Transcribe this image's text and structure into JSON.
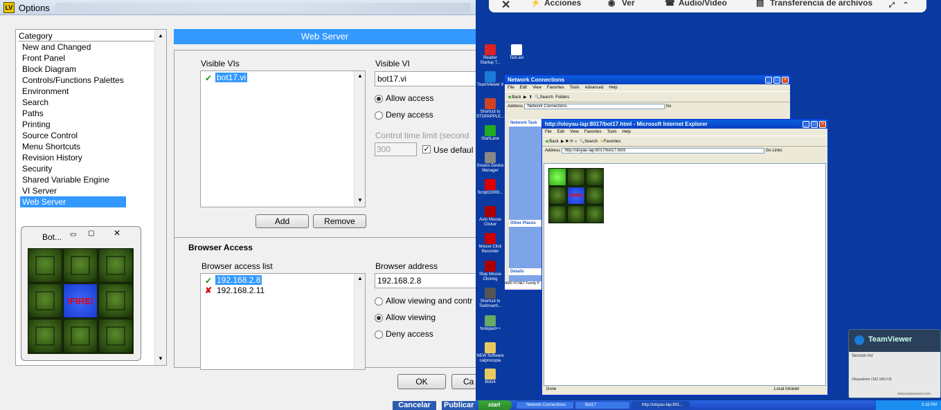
{
  "options": {
    "title": "Options",
    "category_header": "Category",
    "categories": [
      "New and Changed",
      "Front Panel",
      "Block Diagram",
      "Controls/Functions Palettes",
      "Environment",
      "Search",
      "Paths",
      "Printing",
      "Source Control",
      "Menu Shortcuts",
      "Revision History",
      "Security",
      "Shared Variable Engine",
      "VI Server",
      "Web Server"
    ],
    "selected_category": "Web Server",
    "section_title": "Web Server",
    "visible_vis_label": "Visible VIs",
    "visible_vis": [
      {
        "name": "bot17.vi",
        "status": "allowed"
      }
    ],
    "visible_vi_label": "Visible VI",
    "visible_vi_value": "bot17.vi",
    "allow_access": "Allow access",
    "deny_access": "Deny access",
    "control_time_limit": "Control time limit (second",
    "time_limit_value": "300",
    "use_default": "Use defaul",
    "add": "Add",
    "remove": "Remove",
    "browser_access_title": "Browser Access",
    "browser_access_list_label": "Browser access list",
    "browser_list": [
      {
        "addr": "192.168.2.8",
        "status": "allowed"
      },
      {
        "addr": "192.168.2.11",
        "status": "denied"
      }
    ],
    "browser_address_label": "Browser address",
    "browser_address_value": "192.168.2.8",
    "allow_viewing_control": "Allow viewing and contr",
    "allow_viewing": "Allow viewing",
    "deny_access_b": "Deny access",
    "ok": "OK",
    "cancel_partial": "Ca"
  },
  "bot_panel": {
    "title": "Bot...",
    "fire_label": "!FIRE!"
  },
  "desktop": {
    "teamviewer_bar": [
      "Acciones",
      "Ver",
      "Audio/Video",
      "Transferencia de archivos"
    ],
    "icons": [
      {
        "label": "Reader Startup T...",
        "color": "#d22"
      },
      {
        "label": "TeamViewer 9",
        "color": "#1a7ad8"
      },
      {
        "label": "Shortcut to STOPAPPLE...",
        "color": "#c42"
      },
      {
        "label": "StartLane",
        "color": "#2a2"
      },
      {
        "label": "Sixaxis Device Manager",
        "color": "#888"
      },
      {
        "label": "Script10000...",
        "color": "#d00"
      },
      {
        "label": "Auto Mouse Clicker",
        "color": "#a00"
      },
      {
        "label": "Mouse Click Recorder",
        "color": "#c00"
      },
      {
        "label": "Stop Mouse Clicking",
        "color": "#a00"
      },
      {
        "label": "Shortcut to TextInserti...",
        "color": "#555"
      },
      {
        "label": "Notepad++",
        "color": "#6a6"
      },
      {
        "label": "NEW Software calprocopia",
        "color": "#e8c860"
      },
      {
        "label": "Bots4",
        "color": "#e8c860"
      }
    ],
    "icon2": "Test.avi",
    "net_window": {
      "title": "Network Connections",
      "menu": [
        "File",
        "Edit",
        "View",
        "Favorites",
        "Tools",
        "Advanced",
        "Help"
      ],
      "back": "Back",
      "search": "Search",
      "folders": "Folders",
      "address_label": "Address",
      "address": "Network Connections",
      "go": "Go",
      "tasks": "Network Task",
      "other_places": "Other Places",
      "details": "Details",
      "status": "AMD PCNET Family P"
    },
    "ie_window": {
      "title": "http://oloyau-lap:8017/bot17.html - Microsoft Internet Explorer",
      "menu": [
        "File",
        "Edit",
        "View",
        "Favorites",
        "Tools",
        "Help"
      ],
      "back": "Back",
      "search": "Search",
      "favorites": "Favorites",
      "address_label": "Address",
      "address": "http://oloyau-lap:8017/bot17.html",
      "go": "Go",
      "links": "Links",
      "status_left": "Done",
      "status_right": "Local intranet"
    },
    "taskbar": {
      "start": "start",
      "items": [
        "Network Connections",
        "Bot17",
        "http://oloyau-lap:801..."
      ],
      "clock": "3:18 PM"
    },
    "teamviewer_panel": {
      "title": "TeamViewer",
      "session_list": "Session list",
      "session": "Oloyaulever (192.168.2.8)",
      "link": "www.teamviewer.com"
    },
    "under_buttons": [
      "Cancelar",
      "Publicar"
    ]
  }
}
